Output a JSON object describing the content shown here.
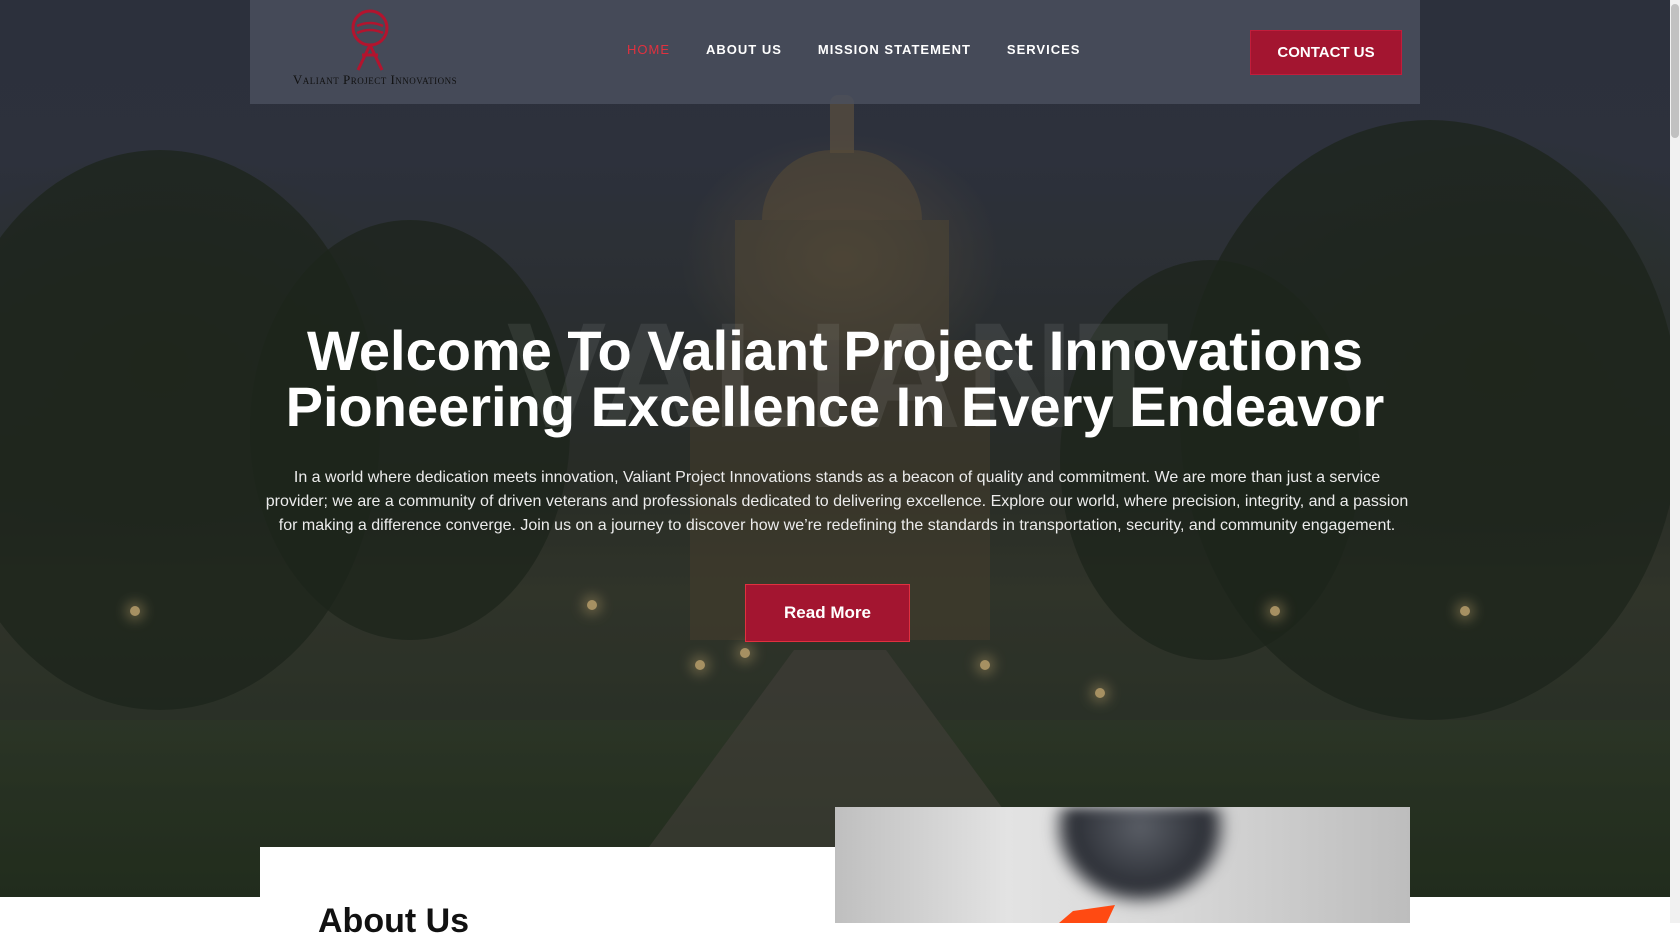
{
  "site": {
    "logo_text": "Valiant Project Innovations"
  },
  "nav": {
    "items": [
      {
        "label": "HOME",
        "active": true
      },
      {
        "label": "ABOUT US",
        "active": false
      },
      {
        "label": "MISSION STATEMENT",
        "active": false
      },
      {
        "label": "SERVICES",
        "active": false
      }
    ],
    "contact_label": "CONTACT US"
  },
  "hero": {
    "watermark": "VALIANT",
    "title_line1": "Welcome To Valiant Project Innovations",
    "title_line2": "Pioneering Excellence In Every Endeavor",
    "intro": "In a world where dedication meets innovation, Valiant Project Innovations stands as a beacon of quality and commitment. We are more than just a service provider; we are a community of driven veterans and professionals dedicated to delivering excellence. Explore our world, where precision, integrity, and a passion for making a difference converge. Join us on a journey to discover how we’re redefining the standards in transportation, security, and community engagement.",
    "button_label": "Read More"
  },
  "about": {
    "heading": "About Us"
  },
  "colors": {
    "brand_red": "#a31530",
    "active_nav": "#e0313f",
    "header_bg": "#4b505e",
    "about_arrow": "#ff4a12"
  },
  "icons": {
    "logo_mark": "valiant-emblem-icon"
  }
}
